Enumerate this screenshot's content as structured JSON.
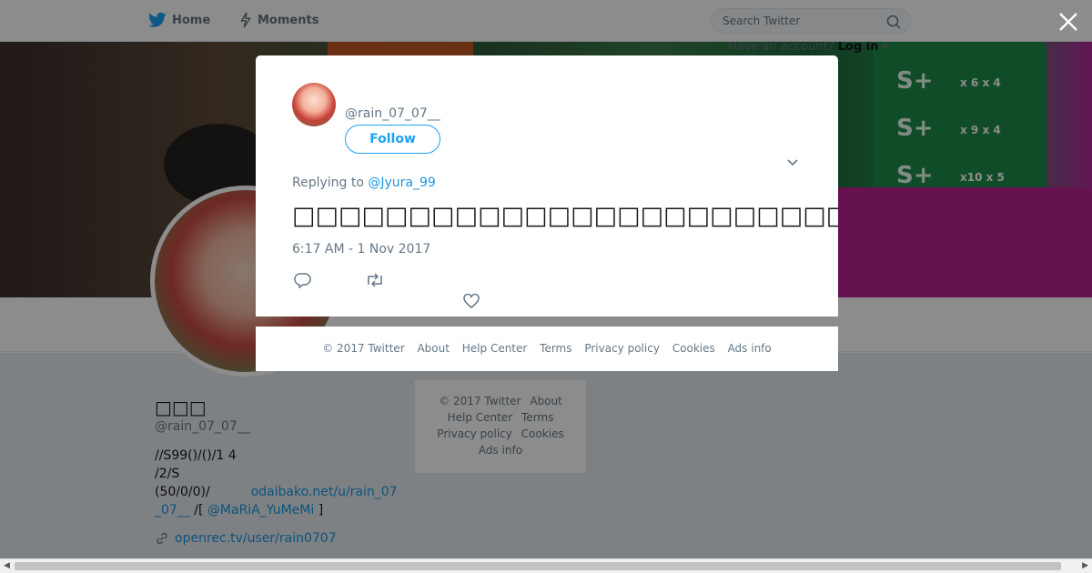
{
  "topbar": {
    "home_label": "Home",
    "moments_label": "Moments",
    "search_placeholder": "Search Twitter",
    "login_prefix": "Have an account?",
    "login_label": "Log in"
  },
  "banner": {
    "stats": [
      {
        "rank": "S+",
        "detail": "x 6  x 4"
      },
      {
        "rank": "S+",
        "detail": "x 9  x 4"
      },
      {
        "rank": "S+",
        "detail": "x10  x 5"
      }
    ]
  },
  "profile": {
    "name": "□□□",
    "handle": "@rain_07_07__",
    "bio_line1": "//S99()/()/1 4",
    "bio_line2": "/2/S",
    "bio_line3_prefix": "(50/0/0)/",
    "bio_link1": "odaibako.net/u/rain_07_07__",
    "bio_mid": " /[ ",
    "bio_link2": "@MaRiA_YuMeMi",
    "bio_suffix": " ]",
    "url": "openrec.tv/user/rain0707"
  },
  "profile_footer": {
    "items": [
      "© 2017 Twitter",
      "About",
      "Help Center",
      "Terms",
      "Privacy policy",
      "Cookies",
      "Ads info"
    ]
  },
  "tweet": {
    "handle": "@rain_07_07__",
    "follow_label": "Follow",
    "replying_prefix": "Replying to",
    "replying_to": "@Jyura_99",
    "text": "□□□□□□□□□□□□□□□□□□□□□□□□□□□□□□□□□□□□□□□□□□□□□□□□□□(□□□□□□□□□□)□□□□□□□□",
    "timestamp": "6:17 AM - 1 Nov 2017"
  },
  "modal_footer": {
    "items": [
      "© 2017 Twitter",
      "About",
      "Help Center",
      "Terms",
      "Privacy policy",
      "Cookies",
      "Ads info"
    ]
  },
  "colors": {
    "accent": "#1da1f2",
    "link": "#1b95e0",
    "overlay": "rgba(0,0,0,0.45)"
  }
}
